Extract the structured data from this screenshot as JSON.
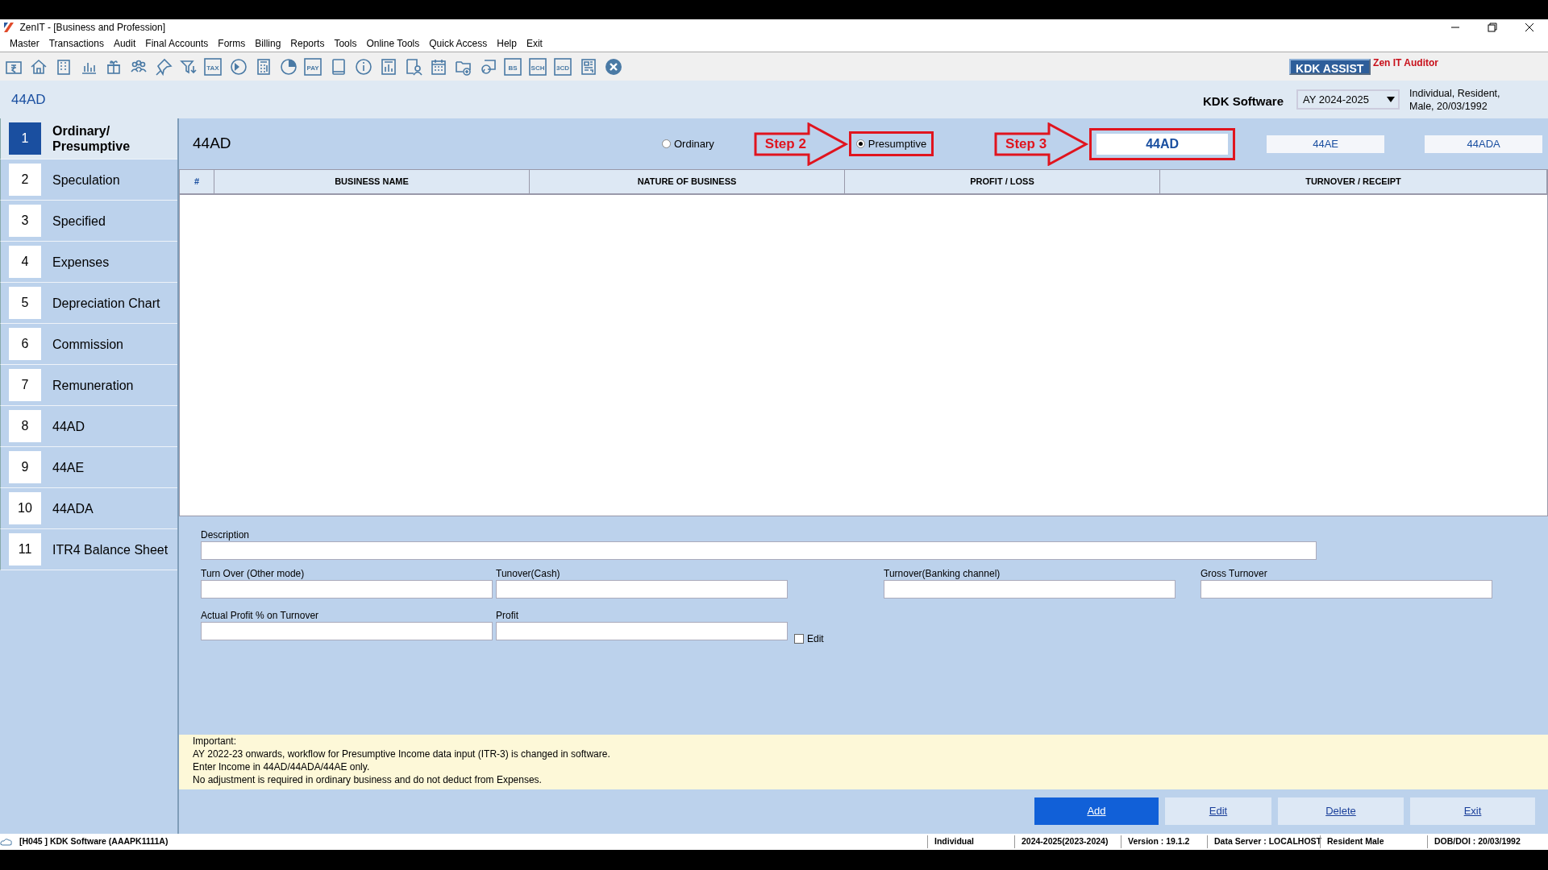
{
  "window": {
    "title": "ZenIT - [Business and Profession]"
  },
  "menu": [
    "Master",
    "Transactions",
    "Audit",
    "Final Accounts",
    "Forms",
    "Billing",
    "Reports",
    "Tools",
    "Online Tools",
    "Quick Access",
    "Help",
    "Exit"
  ],
  "toolbar": [
    {
      "kind": "rupee"
    },
    {
      "kind": "home"
    },
    {
      "kind": "building"
    },
    {
      "kind": "bars"
    },
    {
      "kind": "gift"
    },
    {
      "kind": "people"
    },
    {
      "kind": "pin"
    },
    {
      "kind": "filter"
    },
    {
      "kind": "labeled",
      "label": "TAX"
    },
    {
      "kind": "disc"
    },
    {
      "kind": "calculator"
    },
    {
      "kind": "pie"
    },
    {
      "kind": "labeled",
      "label": "PAY"
    },
    {
      "kind": "book"
    },
    {
      "kind": "info"
    },
    {
      "kind": "report"
    },
    {
      "kind": "userdoc"
    },
    {
      "kind": "calendar"
    },
    {
      "kind": "folderadd"
    },
    {
      "kind": "bubble"
    },
    {
      "kind": "labeled",
      "label": "BS"
    },
    {
      "kind": "labeled",
      "label": "SCH"
    },
    {
      "kind": "labeled",
      "label": "3CD"
    },
    {
      "kind": "griddoc"
    },
    {
      "kind": "close"
    }
  ],
  "assist": {
    "button": "KDK ASSIST",
    "product": "Zen IT Auditor"
  },
  "header": {
    "page_title": "44AD",
    "company": "KDK Software",
    "assessment_year": "AY 2024-2025",
    "assessee_info": "Individual, Resident, Male, 20/03/1992"
  },
  "sidebar": {
    "items": [
      {
        "number": "1",
        "label": "Ordinary/ Presumptive",
        "selected": true
      },
      {
        "number": "2",
        "label": "Speculation",
        "selected": false
      },
      {
        "number": "3",
        "label": "Specified",
        "selected": false
      },
      {
        "number": "4",
        "label": "Expenses",
        "selected": false
      },
      {
        "number": "5",
        "label": "Depreciation Chart",
        "selected": false
      },
      {
        "number": "6",
        "label": "Commission",
        "selected": false
      },
      {
        "number": "7",
        "label": "Remuneration",
        "selected": false
      },
      {
        "number": "8",
        "label": "44AD",
        "selected": false
      },
      {
        "number": "9",
        "label": "44AE",
        "selected": false
      },
      {
        "number": "10",
        "label": "44ADA",
        "selected": false
      },
      {
        "number": "11",
        "label": "ITR4 Balance Sheet",
        "selected": false
      }
    ]
  },
  "section": {
    "title": "44AD",
    "mode_options": [
      {
        "label": "Ordinary",
        "selected": false,
        "highlighted": false
      },
      {
        "label": "Presumptive",
        "selected": true,
        "highlighted": true
      }
    ],
    "annotations": [
      {
        "label": "Step 2"
      },
      {
        "label": "Step 3"
      }
    ],
    "section_tabs": [
      {
        "label": "44AD",
        "selected": true,
        "highlighted": true
      },
      {
        "label": "44AE",
        "selected": false,
        "highlighted": false
      },
      {
        "label": "44ADA",
        "selected": false,
        "highlighted": false
      }
    ]
  },
  "table": {
    "columns": [
      "#",
      "BUSINESS NAME",
      "NATURE OF BUSINESS",
      "PROFIT / LOSS",
      "TURNOVER / RECEIPT"
    ]
  },
  "form": {
    "description": "Description",
    "row_2": [
      "Turn Over (Other mode)",
      "Tunover(Cash)",
      "Turnover(Banking channel)",
      "Gross Turnover"
    ],
    "row_3": [
      "Actual Profit % on Turnover",
      "Profit"
    ],
    "edit_checkbox": {
      "label": "Edit",
      "checked": false
    }
  },
  "notes": {
    "heading": "Important:",
    "lines": [
      "AY 2022-23 onwards, workflow for Presumptive Income data input (ITR-3) is changed in software.",
      "Enter Income in 44AD/44ADA/44AE only.",
      "No adjustment is required in ordinary business and do not deduct from Expenses."
    ]
  },
  "buttons": [
    {
      "label": "Add",
      "kind": "primary"
    },
    {
      "label": "Edit",
      "kind": "default"
    },
    {
      "label": "Delete",
      "kind": "default"
    },
    {
      "label": "Exit",
      "kind": "default"
    }
  ],
  "status_bar": [
    "[H045 ] KDK Software (AAAPK1111A)",
    "Individual",
    "2024-2025(2023-2024)",
    "Version : 19.1.2",
    "Data Server : LOCALHOST",
    "Resident Male",
    "DOB/DOI : 20/03/1992"
  ]
}
